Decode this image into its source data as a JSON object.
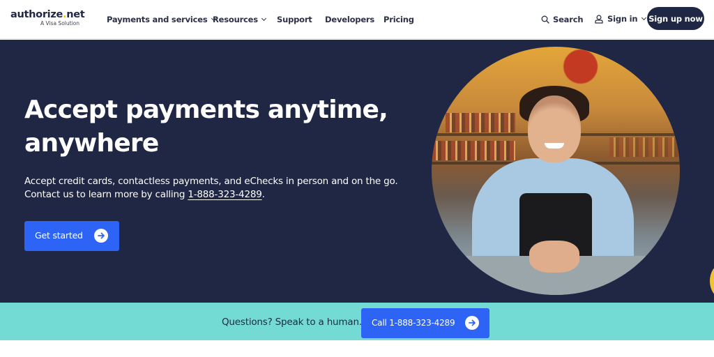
{
  "header": {
    "logo": {
      "brand_prefix": "authorize",
      "brand_dot": ".",
      "brand_suffix": "net",
      "tagline": "A Visa Solution"
    },
    "nav": [
      {
        "label": "Payments and services",
        "has_dropdown": true
      },
      {
        "label": "Resources",
        "has_dropdown": true
      },
      {
        "label": "Support",
        "has_dropdown": false
      },
      {
        "label": "Developers",
        "has_dropdown": false
      },
      {
        "label": "Pricing",
        "has_dropdown": false
      }
    ],
    "search_label": "Search",
    "signin_label": "Sign in",
    "signup_label": "Sign up now"
  },
  "hero": {
    "title": "Accept payments anytime, anywhere",
    "subtitle_part1": "Accept credit cards, contactless payments, and eChecks in person and on the go. Contact us to learn more by calling ",
    "phone": "1-888-323-4289",
    "subtitle_end": ".",
    "cta_label": "Get started",
    "image_alt": "Smiling bartender leaning on counter"
  },
  "contact_strip": {
    "text": "Questions? Speak to a human.",
    "call_label": "Call 1-888-323-4289"
  },
  "colors": {
    "navy": "#1f2744",
    "primary_blue": "#2e64f5",
    "teal": "#73dbd4",
    "logo_dot": "#f5b800"
  }
}
